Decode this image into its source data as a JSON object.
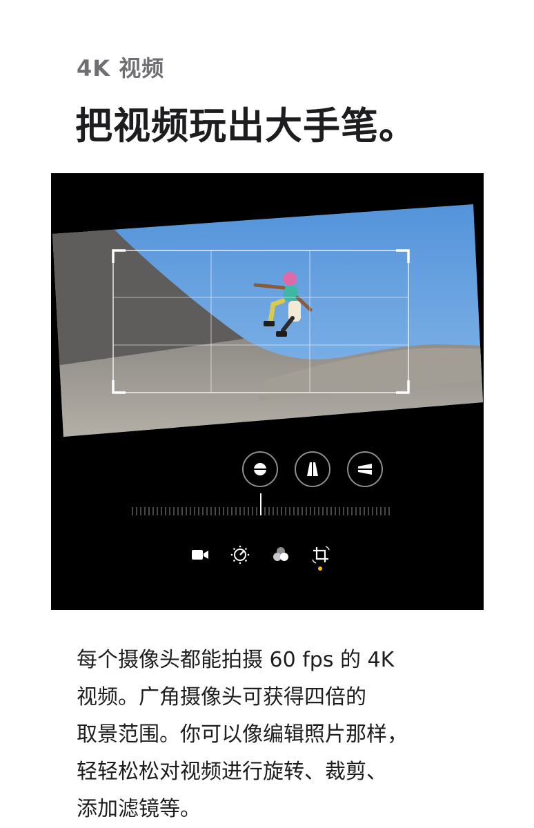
{
  "section": {
    "eyebrow": "4K 视频",
    "headline": "把视频玩出大手笔。"
  },
  "editor": {
    "tools": [
      {
        "icon": "video-camera-icon"
      },
      {
        "icon": "adjust-dial-icon"
      },
      {
        "icon": "filters-icon"
      },
      {
        "icon": "crop-rotate-icon"
      }
    ],
    "controls": [
      {
        "icon": "straighten-icon"
      },
      {
        "icon": "vertical-perspective-icon"
      },
      {
        "icon": "horizontal-perspective-icon"
      }
    ],
    "active_tool": "crop-rotate-icon",
    "accent_color": "#f5c400"
  },
  "description": {
    "lines": [
      "每个摄像头都能拍摄 60 fps 的 4K",
      "视频。广角摄像头可获得四倍的",
      "取景范围。你可以像编辑照片那样，",
      "轻轻松松对视频进行旋转、裁剪、",
      "添加滤镜等。"
    ]
  }
}
